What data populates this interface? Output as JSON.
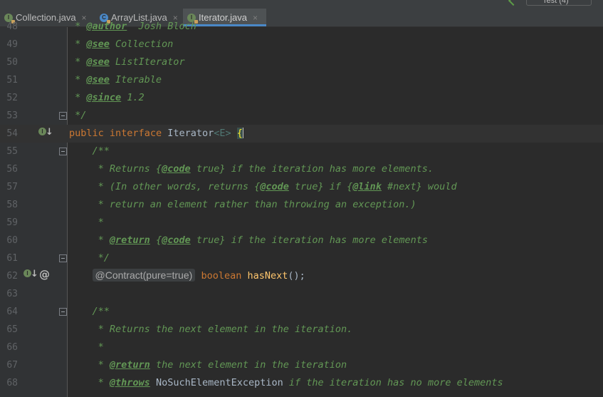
{
  "tabs": [
    {
      "label": "Collection.java",
      "icon": "interface-file-icon",
      "icon_letter": "I",
      "active": false
    },
    {
      "label": "ArrayList.java",
      "icon": "class-file-icon",
      "icon_letter": "C",
      "active": false
    },
    {
      "label": "Iterator.java",
      "icon": "interface-file-icon",
      "icon_letter": "I",
      "active": true
    }
  ],
  "tab_close_glyph": "×",
  "run_config_label": "Test (4)",
  "gutter_icon_letter": "I",
  "code_lines": [
    {
      "n": "48",
      "doc_prefix": " * ",
      "tag": "@author",
      "rest": "  Josh Bloch"
    },
    {
      "n": "49",
      "doc_prefix": " * ",
      "tag": "@see",
      "rest": " Collection"
    },
    {
      "n": "50",
      "doc_prefix": " * ",
      "tag": "@see",
      "rest": " ListIterator"
    },
    {
      "n": "51",
      "doc_prefix": " * ",
      "tag": "@see",
      "rest": " Iterable"
    },
    {
      "n": "52",
      "doc_prefix": " * ",
      "tag": "@since",
      "rest": " 1.2"
    },
    {
      "n": "53",
      "text": " */"
    },
    {
      "n": "54",
      "kw1": "public",
      "kw2": "interface",
      "name": "Iterator",
      "generic": "<E>",
      "brace": "{"
    },
    {
      "n": "55",
      "text": "    /**"
    },
    {
      "n": "56",
      "p1": "     * Returns {",
      "tag": "@code",
      "p2": " true} if the iteration has more elements."
    },
    {
      "n": "57",
      "p1": "     * (In other words, returns {",
      "tag": "@code",
      "p2": " true} if {",
      "tag2": "@link",
      "p3": " #next} would"
    },
    {
      "n": "58",
      "text": "     * return an element rather than throwing an exception.)"
    },
    {
      "n": "59",
      "text": "     *"
    },
    {
      "n": "60",
      "p1": "     * ",
      "tag": "@return",
      "p2": " {",
      "tag2": "@code",
      "p3": " true} if the iteration has more elements"
    },
    {
      "n": "61",
      "text": "     */"
    },
    {
      "n": "62",
      "annotation": "@Contract(pure=true)",
      "type": "boolean",
      "method": "hasNext",
      "tail": "();"
    },
    {
      "n": "63"
    },
    {
      "n": "64",
      "text": "    /**"
    },
    {
      "n": "65",
      "text": "     * Returns the next element in the iteration."
    },
    {
      "n": "66",
      "text": "     *"
    },
    {
      "n": "67",
      "p1": "     * ",
      "tag": "@return",
      "p2": " the next element in the iteration"
    },
    {
      "n": "68",
      "p1": "     * ",
      "tag": "@throws",
      "plain": " NoSuchElementException",
      "p2": " if the iteration has no more elements"
    }
  ]
}
